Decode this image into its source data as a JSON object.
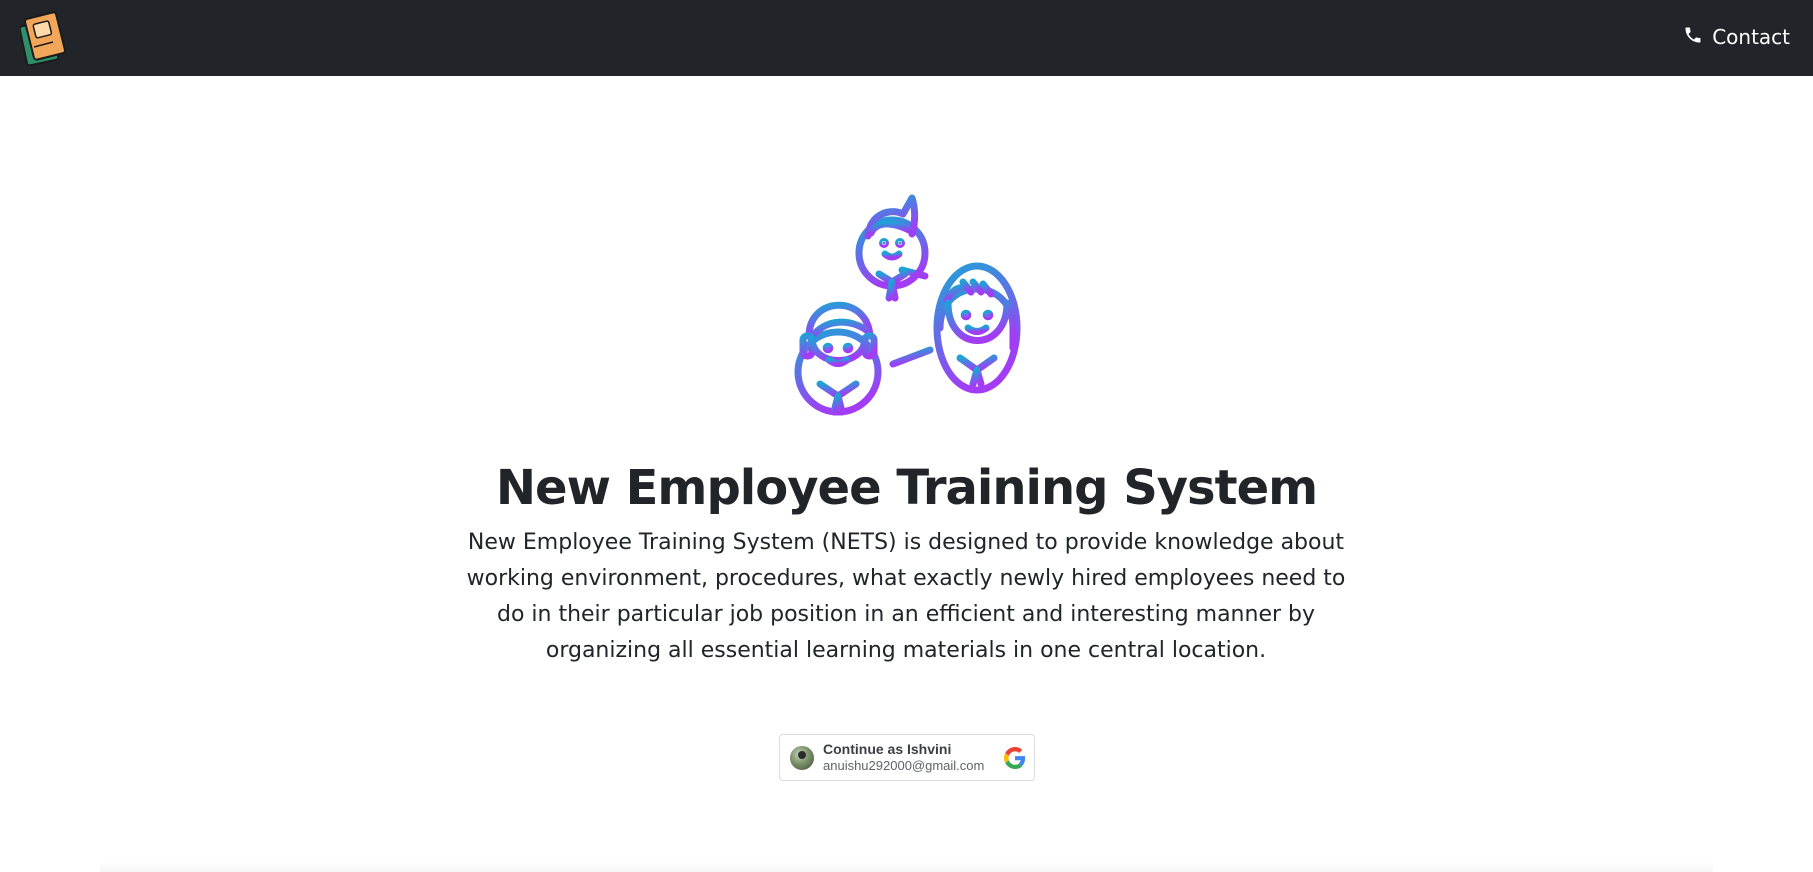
{
  "navbar": {
    "logo_icon": "books-icon",
    "contact_label": "Contact",
    "contact_icon": "phone-icon",
    "background": "#212529"
  },
  "hero": {
    "illustration": "team-people-icon",
    "title": "New Employee Training System",
    "description": "New Employee Training System (NETS) is designed to provide knowledge about working environment, procedures, what exactly newly hired employees need to do in their particular job position in an efficient and interesting manner by organizing all essential learning materials in one central location.",
    "gradient_colors": [
      "#1fa2d6",
      "#a23cf5"
    ]
  },
  "google_signin": {
    "label": "Continue as Ishvini",
    "email": "anuishu292000@gmail.com",
    "icon": "google-icon"
  }
}
